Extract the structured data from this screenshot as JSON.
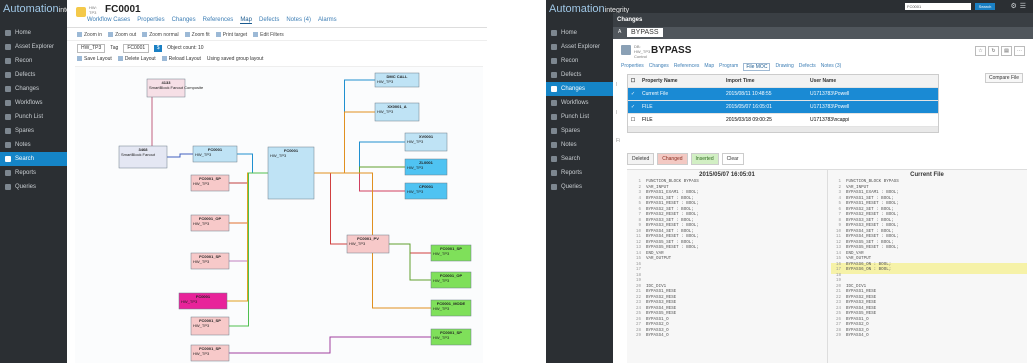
{
  "left": {
    "app": {
      "brand": "Automation",
      "brand_sub": "integrity"
    },
    "nav": [
      {
        "label": "Home"
      },
      {
        "label": "Asset Explorer"
      },
      {
        "label": "Recon"
      },
      {
        "label": "Defects"
      },
      {
        "label": "Changes"
      },
      {
        "label": "Workflows"
      },
      {
        "label": "Punch List"
      },
      {
        "label": "Spares"
      },
      {
        "label": "Notes"
      },
      {
        "label": "Search",
        "active": true
      },
      {
        "label": "Reports"
      },
      {
        "label": "Queries"
      }
    ],
    "header": {
      "tag": "HW: TP3",
      "title": "FC0001",
      "tabs": [
        "Workflow Cases",
        "Properties",
        "Changes",
        "References",
        "Map",
        "Defects",
        "Notes (4)",
        "Alarms"
      ],
      "active_tab": "Map"
    },
    "toolbar": [
      "Zoom in",
      "Zoom out",
      "Zoom normal",
      "Zoom fit",
      "Print target",
      "Edit Filters"
    ],
    "filter": {
      "value1": "HW_TP3",
      "label": "Tag",
      "value2": "FC0001",
      "count_label": "Object count: 10"
    },
    "layout_buttons": [
      "Save Layout",
      "Delete Layout",
      "Reload Layout",
      "Using saved group layout"
    ],
    "nodes": [
      {
        "id": "n1",
        "name": "4133",
        "sub": "SmartBlock Fanout  Composite",
        "color": "#f6dfe6"
      },
      {
        "id": "n2",
        "name": "3468",
        "sub": "SmartBlock Fanout",
        "color": "#e4e7f3"
      },
      {
        "id": "n3",
        "name": "FC0001",
        "sub": "HW_TP3",
        "color": "#bfe3f5"
      },
      {
        "id": "n4",
        "name": "FC0001",
        "sub": "HW_TP3",
        "color": "#bfe3f5"
      },
      {
        "id": "n5",
        "name": "DMC CALL",
        "sub": "HW_TP3",
        "color": "#bfe3f5"
      },
      {
        "id": "n6",
        "name": "XX0001_A",
        "sub": "HW_TP3",
        "color": "#bfe3f5"
      },
      {
        "id": "n7",
        "name": "XV0001",
        "sub": "HW_TP3",
        "color": "#bfe3f5"
      },
      {
        "id": "n8",
        "name": "ZL0001",
        "sub": "HW_TP3",
        "color": "#4fc3f2"
      },
      {
        "id": "n9",
        "name": "CF0001",
        "sub": "HW_TP3",
        "color": "#4fc3f2"
      },
      {
        "id": "n10",
        "name": "FC0001_SP",
        "sub": "HW_TP3",
        "color": "#f7c9c9"
      },
      {
        "id": "n11",
        "name": "FC0001_PV",
        "sub": "HW_TP3",
        "color": "#f7c9c9"
      },
      {
        "id": "n12",
        "name": "FC0001_OP",
        "sub": "HW_TP3",
        "color": "#f7c9c9"
      },
      {
        "id": "n13",
        "name": "FC0001_SP",
        "sub": "HW_TP3",
        "color": "#f7c9c9"
      },
      {
        "id": "n14",
        "name": "FC0001",
        "sub": "HW_TP3",
        "color": "#e8239a"
      },
      {
        "id": "n15",
        "name": "FC0001_SP",
        "sub": "HW_TP3",
        "color": "#f7c9c9"
      },
      {
        "id": "n16",
        "name": "FC0001_SP",
        "sub": "HW_TP3",
        "color": "#f7c9c9"
      },
      {
        "id": "n17",
        "name": "FC0001_SP",
        "sub": "HW_TP3",
        "color": "#7fe05a"
      },
      {
        "id": "n18",
        "name": "FC0001_OP",
        "sub": "HW_TP3",
        "color": "#7fe05a"
      },
      {
        "id": "n19",
        "name": "FC0001_MODE",
        "sub": "HW_TP3",
        "color": "#7fe05a"
      },
      {
        "id": "n20",
        "name": "FC0001_SP",
        "sub": "HW_TP3",
        "color": "#7fe05a"
      }
    ]
  },
  "right": {
    "app": {
      "brand": "Automation",
      "brand_sub": "integrity"
    },
    "search_value": "FC0001",
    "search_button": "Search",
    "nav": [
      {
        "label": "Home"
      },
      {
        "label": "Asset Explorer"
      },
      {
        "label": "Recon"
      },
      {
        "label": "Defects"
      },
      {
        "label": "Changes",
        "active": true
      },
      {
        "label": "Workflows"
      },
      {
        "label": "Punch List"
      },
      {
        "label": "Spares"
      },
      {
        "label": "Notes"
      },
      {
        "label": "Search"
      },
      {
        "label": "Reports"
      },
      {
        "label": "Queries"
      }
    ],
    "bar_title": "Changes",
    "bar_tab_prefix": "A",
    "bar_tab": "BYPASS",
    "card": {
      "tag": "DB: HW_TP3 Control",
      "title": "BYPASS",
      "tabs": [
        "Properties",
        "Changes",
        "References",
        "Map",
        "Program",
        "File MOC",
        "Drawing",
        "Defects",
        "Notes (3)"
      ],
      "active_tab": "File MOC",
      "compare_button": "Compare File",
      "side_letters": [
        "I",
        "I",
        "Fi"
      ]
    },
    "table": {
      "headers": [
        "Property Name",
        "Import Time",
        "User Name"
      ],
      "rows": [
        {
          "name": "Current File",
          "time": "2015/08/11 10:48:55",
          "user": "U1713783\\Powell",
          "selected": true
        },
        {
          "name": "FILE",
          "time": "2015/05/07 16:05:01",
          "user": "U1713783\\Powell",
          "selected": true
        },
        {
          "name": "FILE",
          "time": "2015/03/18 09:00:25",
          "user": "U1713783\\ncappi",
          "selected": false
        }
      ]
    },
    "diff_buttons": [
      "Deleted",
      "Changed",
      "Inserted",
      "Clear"
    ],
    "left_pane": {
      "title": "2015/05/07 16:05:01",
      "lines": [
        "FUNCTION_BLOCK BYPASS",
        "VAR_INPUT",
        "BYPASS1_EXAM1 : BOOL;",
        "BYPASS1_SET : BOOL;",
        "BYPASS1_RESET : BOOL;",
        "BYPASS2_SET : BOOL;",
        "BYPASS2_RESET : BOOL;",
        "BYPASS3_SET : BOOL;",
        "BYPASS3_RESET : BOOL;",
        "BYPASS4_SET : BOOL;",
        "BYPASS4_RESET : BOOL;",
        "BYPASS5_SET : BOOL;",
        "BYPASS5_RESET : BOOL;",
        "END_VAR",
        "VAR_OUTPUT",
        "",
        "",
        "",
        "",
        "IDC_DIV1",
        "BYPASS1_RESE",
        "BYPASS2_RESE",
        "BYPASS3_RESE",
        "BYPASS4_RESE",
        "BYPASS5_RESE",
        "BYPASS1_O",
        "BYPASS2_O",
        "BYPASS3_O",
        "BYPASS4_O"
      ]
    },
    "right_pane": {
      "title": "Current File",
      "lines": [
        "FUNCTION_BLOCK BYPASS",
        "VAR_INPUT",
        "BYPASS1_EXAM1 : BOOL;",
        "BYPASS1_SET : BOOL;",
        "BYPASS1_RESET : BOOL;",
        "BYPASS2_SET : BOOL;",
        "BYPASS2_RESET : BOOL;",
        "BYPASS3_SET : BOOL;",
        "BYPASS3_RESET : BOOL;",
        "BYPASS4_SET : BOOL;",
        "BYPASS4_RESET : BOOL;",
        "BYPASS5_SET : BOOL;",
        "BYPASS5_RESET : BOOL;",
        "END_VAR",
        "VAR_OUTPUT",
        "BYPASS6_ON : BOOL;",
        "BYPASS6_ON : BOOL;",
        "",
        "",
        "IDC_DIV1",
        "BYPASS1_RESE",
        "BYPASS2_RESE",
        "BYPASS3_RESE",
        "BYPASS4_RESE",
        "BYPASS5_RESE",
        "BYPASS1_O",
        "BYPASS2_O",
        "BYPASS3_O",
        "BYPASS4_O"
      ],
      "changed_lines": [
        16,
        17
      ]
    }
  }
}
